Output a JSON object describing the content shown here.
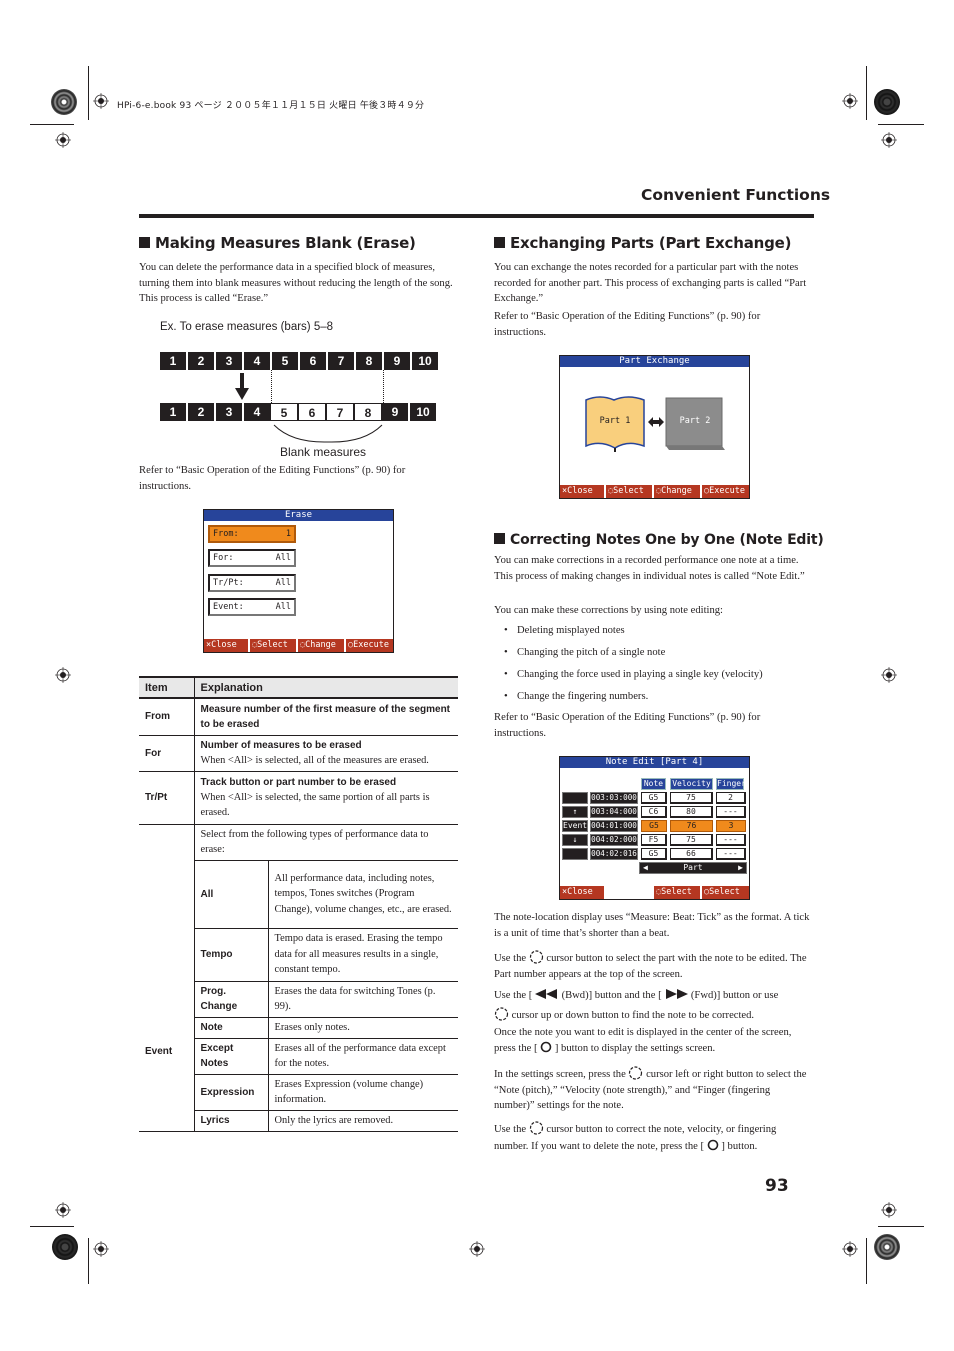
{
  "book_header": "HPi-6-e.book  93 ページ  ２００５年１１月１５日  火曜日  午後３時４９分",
  "section_title": "Convenient Functions",
  "page_number": "93",
  "erase_section": {
    "heading": "Making Measures Blank (Erase)",
    "intro": "You can delete the performance data in a specified block of measures, turning them into blank measures without reducing the length of the song. This process is called “Erase.”",
    "example_label": "Ex. To erase measures (bars) 5–8",
    "diagram": {
      "top_row": [
        "1",
        "2",
        "3",
        "4",
        "5",
        "6",
        "7",
        "8",
        "9",
        "10"
      ],
      "bottom_row": [
        "1",
        "2",
        "3",
        "4",
        "5",
        "6",
        "7",
        "8",
        "9",
        "10"
      ],
      "blank_measures": [
        "5",
        "6",
        "7",
        "8"
      ],
      "blank_label": "Blank measures"
    },
    "refer": "Refer to “Basic Operation of the Editing Functions” (p. 90) for instructions.",
    "screen": {
      "title": "Erase",
      "fields": [
        {
          "label": "From:",
          "value": "1",
          "active": true
        },
        {
          "label": "For:",
          "value": "All",
          "active": false
        },
        {
          "label": "Tr/Pt:",
          "value": "All",
          "active": false
        },
        {
          "label": "Event:",
          "value": "All",
          "active": false
        }
      ],
      "footer": [
        "×Close",
        "Select",
        "Change",
        "Execute"
      ]
    },
    "table": {
      "headers": [
        "Item",
        "Explanation"
      ],
      "rows": [
        {
          "item": "From",
          "bold": "Measure number of the first measure of the segment to be erased",
          "text": ""
        },
        {
          "item": "For",
          "bold": "Number of measures to be erased",
          "text": "When <All> is selected, all of the measures are erased."
        },
        {
          "item": "Tr/Pt",
          "bold": "Track button or part number to be erased",
          "text": "When <All> is selected, the same portion of all parts is erased."
        }
      ],
      "event": {
        "item": "Event",
        "intro": "Select from the following types of performance data to erase:",
        "types": [
          {
            "name": "All",
            "desc": "All performance data, including notes, tempos, Tones switches (Program Change), volume changes, etc., are erased."
          },
          {
            "name": "Tempo",
            "desc": "Tempo data is erased. Erasing the tempo data for all measures results in a single, constant tempo."
          },
          {
            "name": "Prog. Change",
            "desc": "Erases the data for switching Tones (p. 99)."
          },
          {
            "name": "Note",
            "desc": "Erases only notes."
          },
          {
            "name": "Except Notes",
            "desc": "Erases all of the performance data except for the notes."
          },
          {
            "name": "Expression",
            "desc": "Erases Expression (volume change) information."
          },
          {
            "name": "Lyrics",
            "desc": "Only the lyrics are removed."
          }
        ]
      }
    }
  },
  "part_exchange_section": {
    "heading": "Exchanging Parts (Part Exchange)",
    "intro": "You can exchange the notes recorded for a particular part with the notes recorded for another part. This process of exchanging parts is called “Part Exchange.”",
    "refer": "Refer to “Basic Operation of the Editing Functions” (p. 90) for instructions.",
    "screen": {
      "title": "Part Exchange",
      "part1": "Part 1",
      "part2": "Part 2",
      "footer": [
        "×Close",
        "Select",
        "Change",
        "Execute"
      ]
    }
  },
  "note_edit_section": {
    "heading": "Correcting Notes One by One (Note Edit)",
    "intro": "You can make corrections in a recorded performance one note at a time. This process of making changes in individual notes is called “Note Edit.”",
    "list_intro": "You can make these corrections by using note editing:",
    "bullets": [
      "Deleting misplayed notes",
      "Changing the pitch of a single note",
      "Changing the force used in playing a single key (velocity)",
      "Change the fingering numbers."
    ],
    "refer": "Refer to “Basic Operation of the Editing Functions” (p. 90) for instructions.",
    "screen": {
      "title": "Note Edit [Part 4]",
      "columns": [
        "Note",
        "Velocity",
        "Finger"
      ],
      "side_labels": [
        "",
        "↑",
        "Event",
        "↓",
        ""
      ],
      "rows": [
        {
          "time": "003:03:000",
          "note": "G5",
          "velocity": "75",
          "finger": "2",
          "selected": false
        },
        {
          "time": "003:04:000",
          "note": "C6",
          "velocity": "80",
          "finger": "---",
          "selected": false
        },
        {
          "time": "004:01:000",
          "note": "G5",
          "velocity": "76",
          "finger": "3",
          "selected": true
        },
        {
          "time": "004:02:000",
          "note": "F5",
          "velocity": "75",
          "finger": "---",
          "selected": false
        },
        {
          "time": "004:02:016",
          "note": "G5",
          "velocity": "66",
          "finger": "---",
          "selected": false
        }
      ],
      "part_nav": "Part",
      "footer": [
        "×Close",
        "Select",
        "Select"
      ]
    },
    "paragraphs": {
      "format": "The note-location display uses “Measure: Beat: Tick” as the format. A tick is a unit of time that’s shorter than a beat.",
      "p1_a": "Use the",
      "p1_b": "cursor button to select the part with the note to be edited. The Part number appears at the top of the screen.",
      "p2_a": "Use the [",
      "p2_b": "(Bwd)] button and the [",
      "p2_c": "(Fwd)] button or use",
      "p2_d": "cursor up or down button to find the note to be corrected.",
      "p3_a": "Once the note you want to edit is displayed in the center of the screen, press the [",
      "p3_b": "] button to display the settings screen.",
      "p4_a": "In the settings screen, press the",
      "p4_b": "cursor left or right button to select the “Note (pitch),” “Velocity (note strength),” and “Finger (fingering number)” settings for the note.",
      "p5_a": "Use the",
      "p5_b": "cursor button to correct the note, velocity, or fingering number. If you want to delete the note, press the [",
      "p5_c": "] button."
    }
  },
  "colors": {
    "lcd_title": "#27449a",
    "lcd_button": "#b53721",
    "lcd_active": "#f08a1c",
    "part1_fill": "#f9cf7d",
    "part2_fill": "#8c8c8c"
  }
}
